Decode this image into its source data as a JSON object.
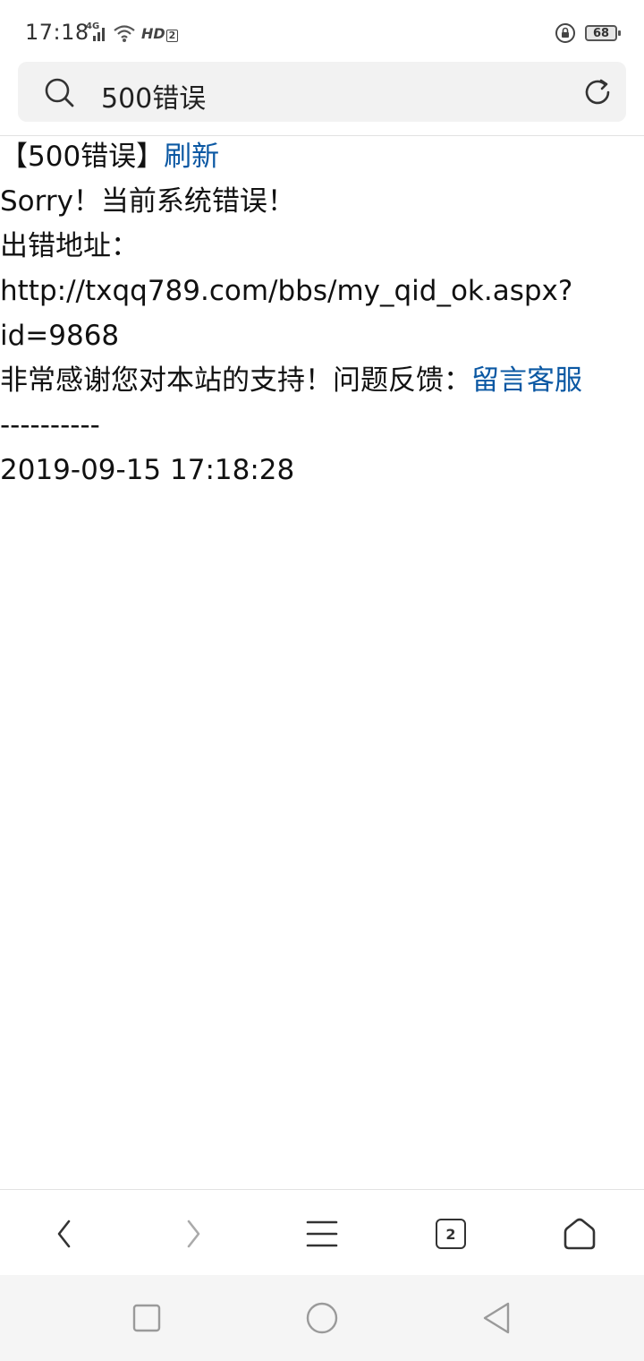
{
  "status_bar": {
    "time": "17:18",
    "network_label": "4G",
    "hd_label": "HD",
    "hd_sub": "2",
    "battery": "68"
  },
  "search": {
    "query": "500错误"
  },
  "page": {
    "title_prefix": "【500错误】",
    "refresh_link": "刷新",
    "sorry_text": "Sorry！当前系统错误！",
    "error_addr_label": "出错地址：",
    "url_line1": "http://txqq789.com/bbs/my_qid_ok.aspx?",
    "url_line2": "id=9868",
    "thanks_text": "非常感谢您对本站的支持！问题反馈：",
    "feedback_link": "留言客服",
    "divider": "----------",
    "timestamp": "2019-09-15 17:18:28"
  },
  "toolbar": {
    "tab_count": "2",
    "back_icon": "chevron-left-icon",
    "forward_icon": "chevron-right-icon",
    "menu_icon": "menu-icon",
    "tabs_icon": "tabs-icon",
    "home_icon": "home-icon"
  },
  "system_nav": {
    "recents_icon": "square-icon",
    "home_icon": "circle-icon",
    "back_icon": "triangle-back-icon"
  }
}
